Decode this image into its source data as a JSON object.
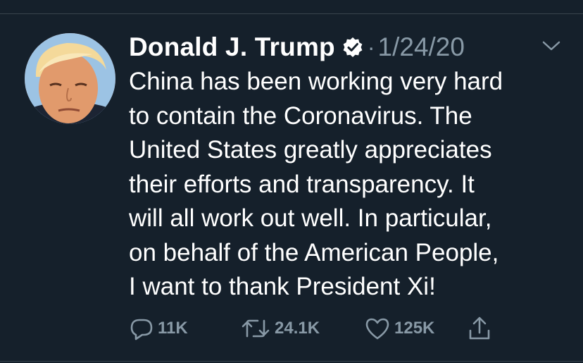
{
  "tweet": {
    "author_name": "Donald J. Trump",
    "separator": "·",
    "date": "1/24/20",
    "text": "China has been working very hard\nto contain the Coronavirus. The\nUnited States greatly appreciates\ntheir efforts and transparency. It\nwill all work out well. In particular,\non behalf of the American People,\nI want to thank President Xi!"
  },
  "actions": {
    "reply_count": "11K",
    "retweet_count": "24.1K",
    "like_count": "125K"
  },
  "icons": {
    "verified": "verified-badge-icon",
    "more": "chevron-down-icon",
    "reply": "reply-icon",
    "retweet": "retweet-icon",
    "like": "heart-icon",
    "share": "share-icon"
  },
  "colors": {
    "background": "#15202b",
    "text_primary": "#ffffff",
    "text_secondary": "#8899a6",
    "divider": "#38444d"
  }
}
